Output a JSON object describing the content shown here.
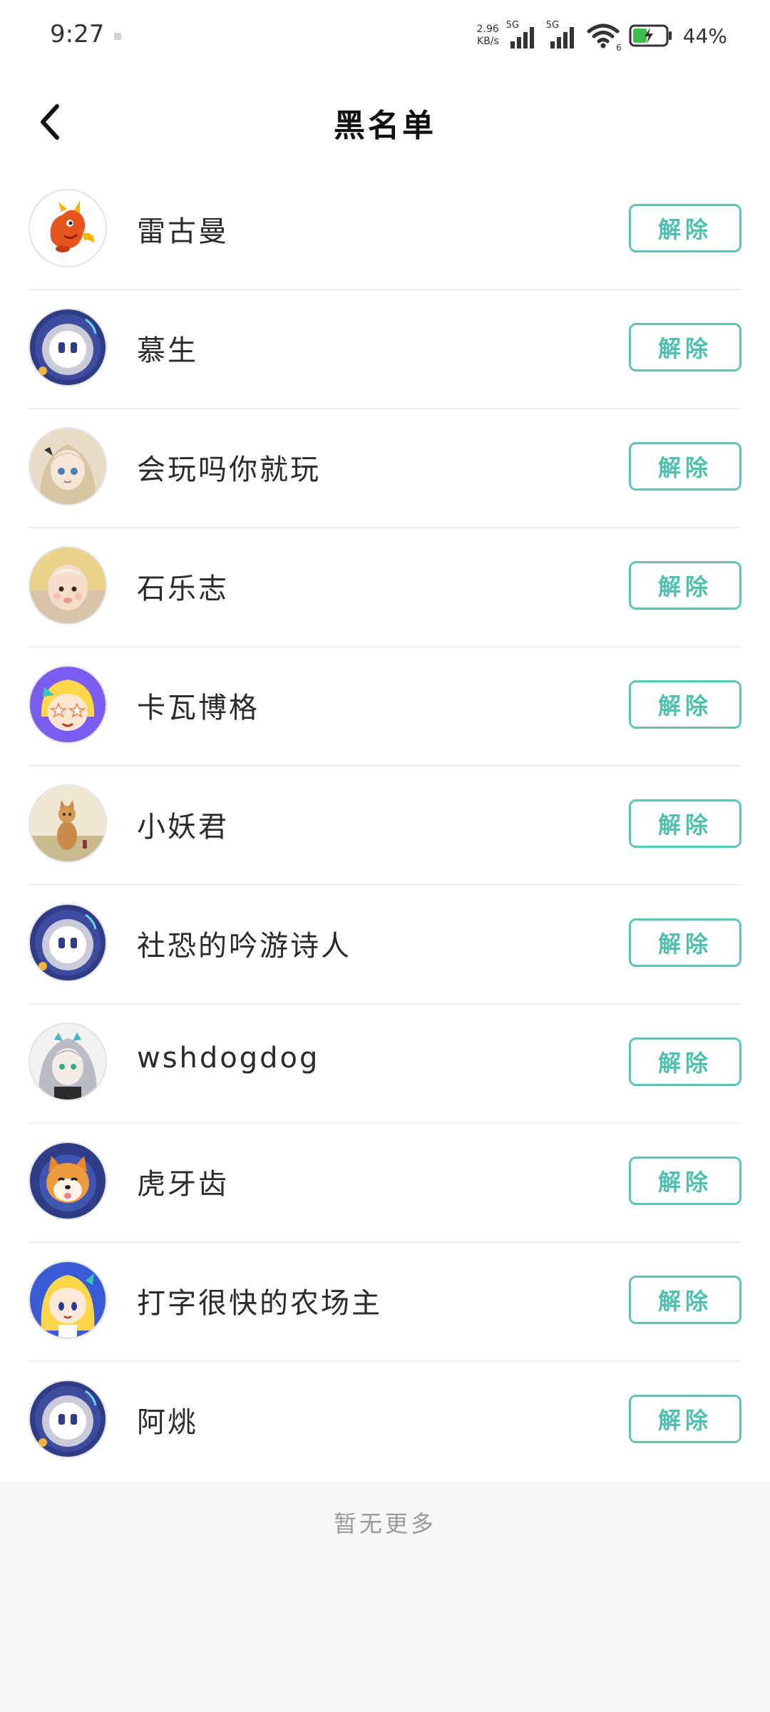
{
  "status_bar": {
    "time": "9:27",
    "net_speed_value": "2.96",
    "net_speed_unit": "KB/s",
    "sim1_tag": "5G",
    "sim2_tag": "5G",
    "wifi_tag": "6",
    "battery_percent": "44%",
    "battery_level": 0.44
  },
  "header": {
    "title": "黑名单",
    "back_icon": "chevron-left-icon"
  },
  "blacklist": {
    "remove_label": "解除",
    "users": [
      {
        "name": "雷古曼",
        "avatar": "dragon-avatar"
      },
      {
        "name": "慕生",
        "avatar": "robot-avatar"
      },
      {
        "name": "会玩吗你就玩",
        "avatar": "anime-girl-avatar"
      },
      {
        "name": "石乐志",
        "avatar": "baby-photo-avatar"
      },
      {
        "name": "卡瓦博格",
        "avatar": "star-eyes-avatar"
      },
      {
        "name": "小妖君",
        "avatar": "cat-photo-avatar"
      },
      {
        "name": "社恐的吟游诗人",
        "avatar": "robot-avatar"
      },
      {
        "name": "wshdogdog",
        "avatar": "silver-hair-avatar"
      },
      {
        "name": "虎牙齿",
        "avatar": "shiba-avatar"
      },
      {
        "name": "打字很快的农场主",
        "avatar": "blonde-character-avatar"
      },
      {
        "name": "阿烑",
        "avatar": "robot-avatar"
      }
    ]
  },
  "footer": {
    "note": "暂无更多"
  },
  "colors": {
    "accent": "#5ec4b4",
    "background": "#f5f6f8",
    "list_background": "#ffffff",
    "footer_text": "#9a9a9a"
  }
}
